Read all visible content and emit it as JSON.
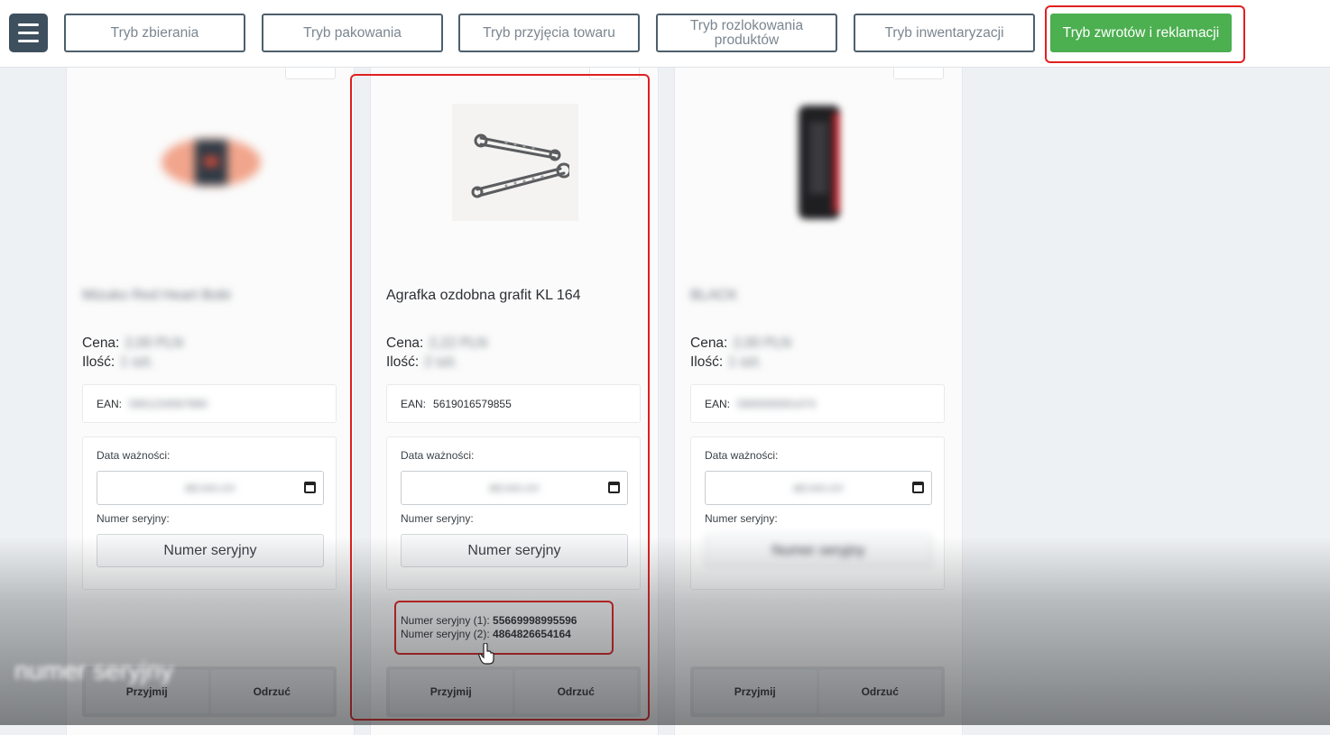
{
  "nav": {
    "menu_icon": "hamburger-menu-icon",
    "modes": [
      {
        "label": "Tryb zbierania",
        "active": false
      },
      {
        "label": "Tryb pakowania",
        "active": false
      },
      {
        "label": "Tryb przyjęcia towaru",
        "active": false
      },
      {
        "label": "Tryb rozlokowania produktów",
        "active": false
      },
      {
        "label": "Tryb inwentaryzacji",
        "active": false
      },
      {
        "label": "Tryb zwrotów i reklamacji",
        "active": true
      }
    ],
    "active_color": "#4caf50"
  },
  "labels": {
    "price": "Cena:",
    "quantity": "Ilość:",
    "ean": "EAN:",
    "expiry_date": "Data ważności:",
    "serial_number": "Numer seryjny:",
    "serial_button": "Numer seryjny",
    "accept": "Przyjmij",
    "reject": "Odrzuć"
  },
  "products": [
    {
      "name": "Mizuko Red Heart Bobi",
      "price": "2,00 PLN",
      "quantity": "1 szt.",
      "ean": "5901234567890",
      "date_placeholder": "dd.mm.rrrr",
      "serials": [],
      "blurred": true
    },
    {
      "name": "Agrafka ozdobna grafit KL 164",
      "price": "2,22 PLN",
      "quantity": "2 szt.",
      "ean": "5619016579855",
      "date_placeholder": "dd.mm.rrrr",
      "serials": [
        {
          "label": "Numer seryjny (1):",
          "value": "55669998995596"
        },
        {
          "label": "Numer seryjny (2):",
          "value": "4864826654164"
        }
      ],
      "blurred": false
    },
    {
      "name": "BLACK",
      "price": "2,00 PLN",
      "quantity": "1 szt.",
      "ean": "5900000001474",
      "date_placeholder": "dd.mm.rrrr",
      "serials": [],
      "blurred": true
    }
  ],
  "caption": "numer seryjny",
  "highlight_color": "#e02020"
}
